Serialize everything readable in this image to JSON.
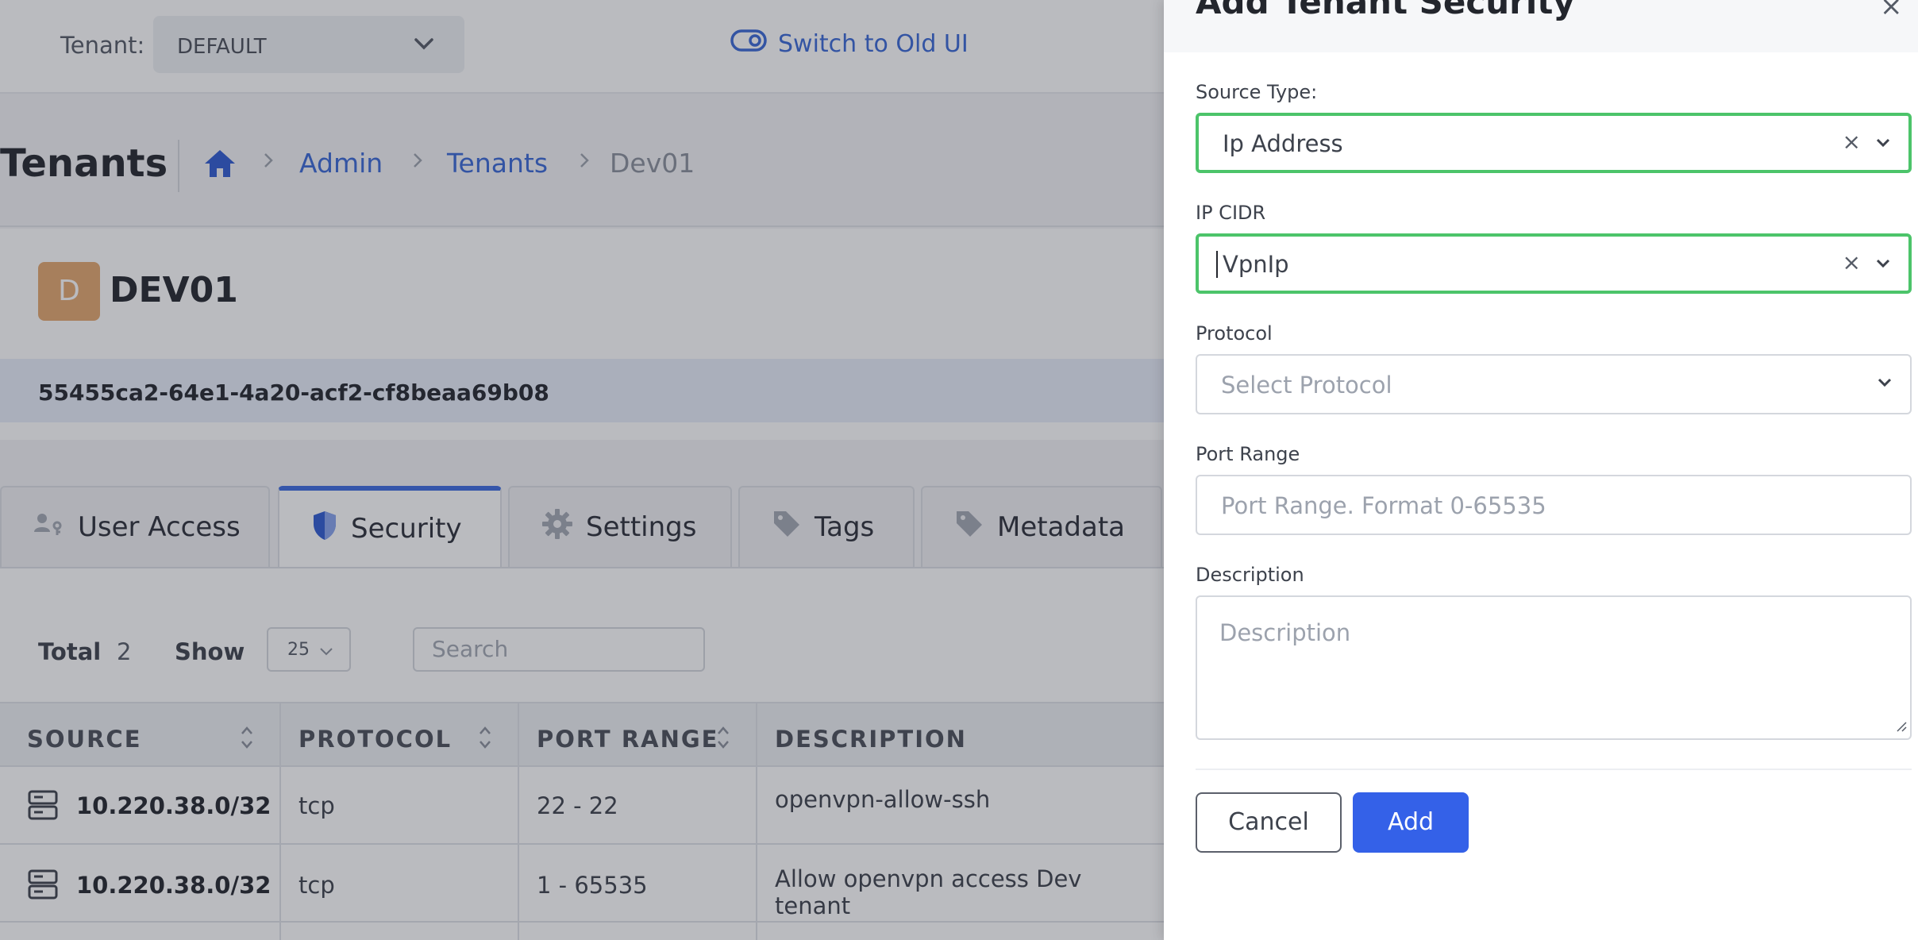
{
  "topbar": {
    "tenant_label": "Tenant:",
    "tenant_value": "DEFAULT",
    "switch_ui_label": "Switch to Old UI"
  },
  "header": {
    "title": "Tenants",
    "breadcrumb": [
      "Admin",
      "Tenants",
      "Dev01"
    ]
  },
  "tenant": {
    "avatar_letter": "D",
    "name": "DEV01",
    "id": "55455ca2-64e1-4a20-acf2-cf8beaa69b08"
  },
  "tabs": [
    {
      "label": "User Access",
      "icon": "user-access-icon",
      "active": false
    },
    {
      "label": "Security",
      "icon": "shield-icon",
      "active": true
    },
    {
      "label": "Settings",
      "icon": "gear-icon",
      "active": false
    },
    {
      "label": "Tags",
      "icon": "tag-icon",
      "active": false
    },
    {
      "label": "Metadata",
      "icon": "tag-icon",
      "active": false
    }
  ],
  "list_controls": {
    "total_label": "Total",
    "total_value": "2",
    "show_label": "Show",
    "page_size": "25",
    "search_placeholder": "Search"
  },
  "table": {
    "columns": [
      "SOURCE",
      "PROTOCOL",
      "PORT RANGE",
      "DESCRIPTION"
    ],
    "rows": [
      {
        "source": "10.220.38.0/32",
        "protocol": "tcp",
        "port_range": "22 - 22",
        "description": "openvpn-allow-ssh"
      },
      {
        "source": "10.220.38.0/32",
        "protocol": "tcp",
        "port_range": "1 - 65535",
        "description": "Allow openvpn access Dev tenant"
      }
    ]
  },
  "panel": {
    "title": "Add Tenant Security",
    "close": "×",
    "source_type": {
      "label": "Source Type:",
      "value": "Ip Address"
    },
    "ip_cidr": {
      "label": "IP CIDR",
      "value": "VpnIp"
    },
    "protocol": {
      "label": "Protocol",
      "placeholder": "Select Protocol"
    },
    "port_range": {
      "label": "Port Range",
      "placeholder": "Port Range. Format 0-65535"
    },
    "description": {
      "label": "Description",
      "placeholder": "Description"
    },
    "clear_symbol": "×",
    "cancel_label": "Cancel",
    "add_label": "Add"
  },
  "colors": {
    "accent": "#3461e8",
    "link": "#3867d6",
    "focus_border": "#4cc46a",
    "avatar": "#e3a76e"
  }
}
